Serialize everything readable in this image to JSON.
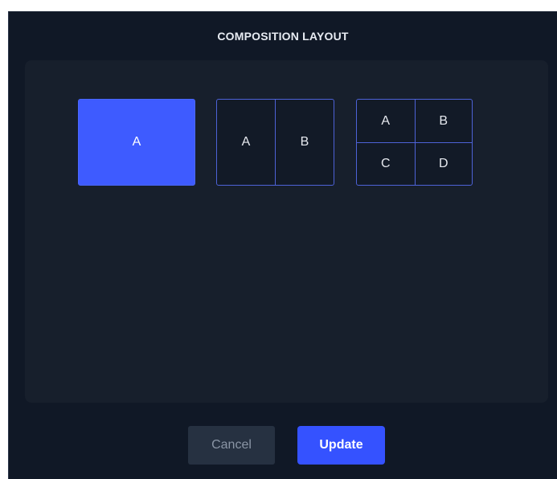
{
  "dialog": {
    "title": "COMPOSITION LAYOUT"
  },
  "layouts": {
    "single": {
      "cells": [
        "A"
      ],
      "selected": true
    },
    "split": {
      "cells": [
        "A",
        "B"
      ],
      "selected": false
    },
    "grid": {
      "cells": [
        "A",
        "B",
        "C",
        "D"
      ],
      "selected": false
    }
  },
  "footer": {
    "cancel_label": "Cancel",
    "update_label": "Update"
  },
  "colors": {
    "dialog_background": "#101826",
    "panel_background": "#171f2c",
    "accent": "#3e5bff",
    "layout_border": "#4d62d7",
    "cancel_background": "#263141",
    "cancel_text": "#8a95a5"
  }
}
